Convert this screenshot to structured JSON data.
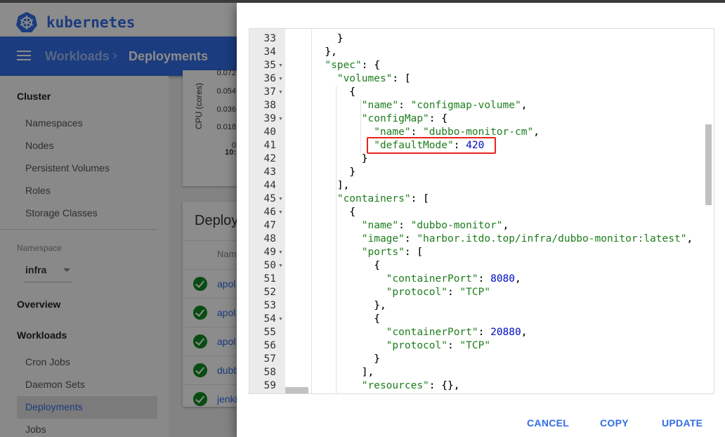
{
  "app": {
    "brand": "kubernetes",
    "accent": "#326de6",
    "breadcrumb": [
      "Workloads",
      "Deployments"
    ]
  },
  "sidebar": {
    "cluster_heading": "Cluster",
    "cluster_items": [
      "Namespaces",
      "Nodes",
      "Persistent Volumes",
      "Roles",
      "Storage Classes"
    ],
    "namespace_label": "Namespace",
    "namespace_value": "infra",
    "overview": "Overview",
    "workloads_heading": "Workloads",
    "workload_items": [
      "Cron Jobs",
      "Daemon Sets",
      "Deployments",
      "Jobs"
    ],
    "selected": "Deployments"
  },
  "cpu_chart": {
    "ylabel": "CPU (cores)",
    "ticks": [
      "0.072",
      "0.054",
      "0.036",
      "0.018",
      "0"
    ],
    "x_tick": "10:"
  },
  "deployments": {
    "title": "Deploy",
    "name_header": "Nam",
    "rows": [
      "apol",
      "apol",
      "apol",
      "dubb",
      "jenki"
    ],
    "status": "running"
  },
  "dialog": {
    "editor": {
      "first_line": 33,
      "fold_lines": [
        35,
        36,
        37,
        39,
        45,
        46,
        49,
        50,
        54
      ],
      "highlighted_line": 41,
      "lines": [
        "        }",
        "      },",
        "      \"spec\": {",
        "        \"volumes\": [",
        "          {",
        "            \"name\": \"configmap-volume\",",
        "            \"configMap\": {",
        "              \"name\": \"dubbo-monitor-cm\",",
        "              \"defaultMode\": 420",
        "            }",
        "          }",
        "        ],",
        "        \"containers\": [",
        "          {",
        "            \"name\": \"dubbo-monitor\",",
        "            \"image\": \"harbor.itdo.top/infra/dubbo-monitor:latest\",",
        "            \"ports\": [",
        "              {",
        "                \"containerPort\": 8080,",
        "                \"protocol\": \"TCP\"",
        "              },",
        "              {",
        "                \"containerPort\": 20880,",
        "                \"protocol\": \"TCP\"",
        "              }",
        "            ],",
        "            \"resources\": {},"
      ]
    },
    "buttons": {
      "cancel": "CANCEL",
      "copy": "COPY",
      "update": "UPDATE"
    }
  }
}
